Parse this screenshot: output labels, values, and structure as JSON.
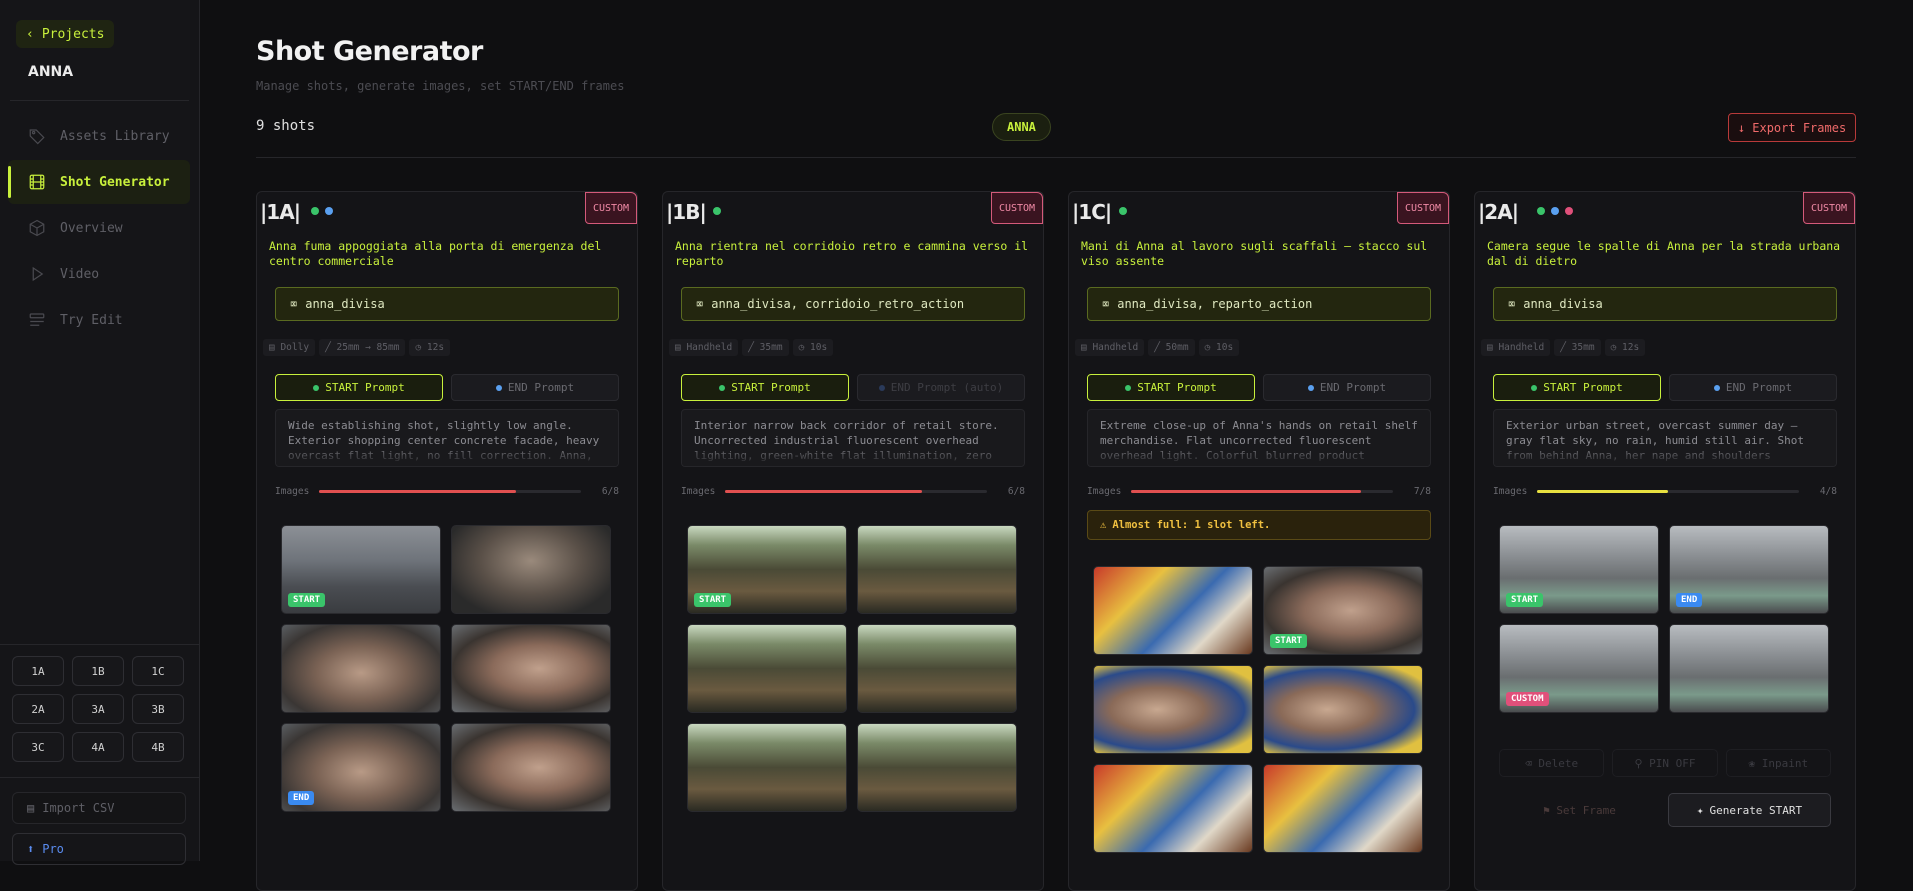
{
  "sidebar": {
    "back_label": "Projects",
    "project_name": "ANNA",
    "nav": [
      {
        "label": "Assets Library"
      },
      {
        "label": "Shot Generator"
      },
      {
        "label": "Overview"
      },
      {
        "label": "Video"
      },
      {
        "label": "Try Edit"
      }
    ],
    "shots": [
      "1A",
      "1B",
      "1C",
      "2A",
      "3A",
      "3B",
      "3C",
      "4A",
      "4B"
    ],
    "import_label": "Import CSV",
    "pro_label": "Pro"
  },
  "header": {
    "title": "Shot Generator",
    "subtitle": "Manage shots, generate images, set START/END frames",
    "shot_count": "9 shots",
    "project_badge": "ANNA",
    "export_label": "↓ Export Frames"
  },
  "colors": {
    "accent": "#c8f03c",
    "start": "#3ac46a",
    "end": "#3a8af0",
    "custom": "#e0507a",
    "danger": "#f06a6a",
    "warn": "#f0c040"
  },
  "cards": [
    {
      "id": "|1A|",
      "badge": "CUSTOM",
      "title": "Anna fuma appoggiata alla porta di emergenza del centro commerciale",
      "assets": "anna_divisa",
      "meta": {
        "move": "Dolly",
        "lens": "25mm → 85mm",
        "duration": "12s"
      },
      "start_tab": "START Prompt",
      "end_tab": "END Prompt",
      "prompt": "Wide establishing shot, slightly low angle. Exterior shopping center concrete facade, heavy overcast flat light, no fill correction. Anna,",
      "images_label": "Images",
      "images_count": "6/8",
      "images_fill": 0.75,
      "bar_color": "#e05050"
    },
    {
      "id": "|1B|",
      "badge": "CUSTOM",
      "title": "Anna rientra nel corridoio retro e cammina verso il reparto",
      "assets": "anna_divisa, corridoio_retro_action",
      "meta": {
        "move": "Handheld",
        "lens": "35mm",
        "duration": "10s"
      },
      "start_tab": "START Prompt",
      "end_tab": "END Prompt (auto)",
      "prompt": "Interior narrow back corridor of retail store. Uncorrected industrial fluorescent overhead lighting, green-white flat illumination, zero",
      "images_label": "Images",
      "images_count": "6/8",
      "images_fill": 0.75,
      "bar_color": "#e05050"
    },
    {
      "id": "|1C|",
      "badge": "CUSTOM",
      "title": "Mani di Anna al lavoro sugli scaffali — stacco sul viso assente",
      "assets": "anna_divisa, reparto_action",
      "meta": {
        "move": "Handheld",
        "lens": "50mm",
        "duration": "10s"
      },
      "start_tab": "START Prompt",
      "end_tab": "END Prompt",
      "prompt": "Extreme close-up of Anna's hands on retail shelf merchandise. Flat uncorrected fluorescent overhead light. Colorful blurred product",
      "images_label": "Images",
      "images_count": "7/8",
      "images_fill": 0.875,
      "bar_color": "#e05050",
      "warning": "Almost full: 1 slot left."
    },
    {
      "id": "|2A|",
      "badge": "CUSTOM",
      "title": "Camera segue le spalle di Anna per la strada urbana dal di dietro",
      "assets": "anna_divisa",
      "meta": {
        "move": "Handheld",
        "lens": "35mm",
        "duration": "12s"
      },
      "start_tab": "START Prompt",
      "end_tab": "END Prompt",
      "prompt": "Exterior urban street, overcast summer day — gray flat sky, no rain, humid still air. Shot from behind Anna, her nape and shoulders",
      "images_label": "Images",
      "images_count": "4/8",
      "images_fill": 0.5,
      "bar_color": "#e8e040",
      "actions": {
        "delete": "Delete",
        "pin": "PIN OFF",
        "inpaint": "Inpaint",
        "set_frame": "Set Frame",
        "generate": "Generate START"
      }
    }
  ],
  "tags": {
    "start": "START",
    "end": "END",
    "custom": "CUSTOM"
  }
}
